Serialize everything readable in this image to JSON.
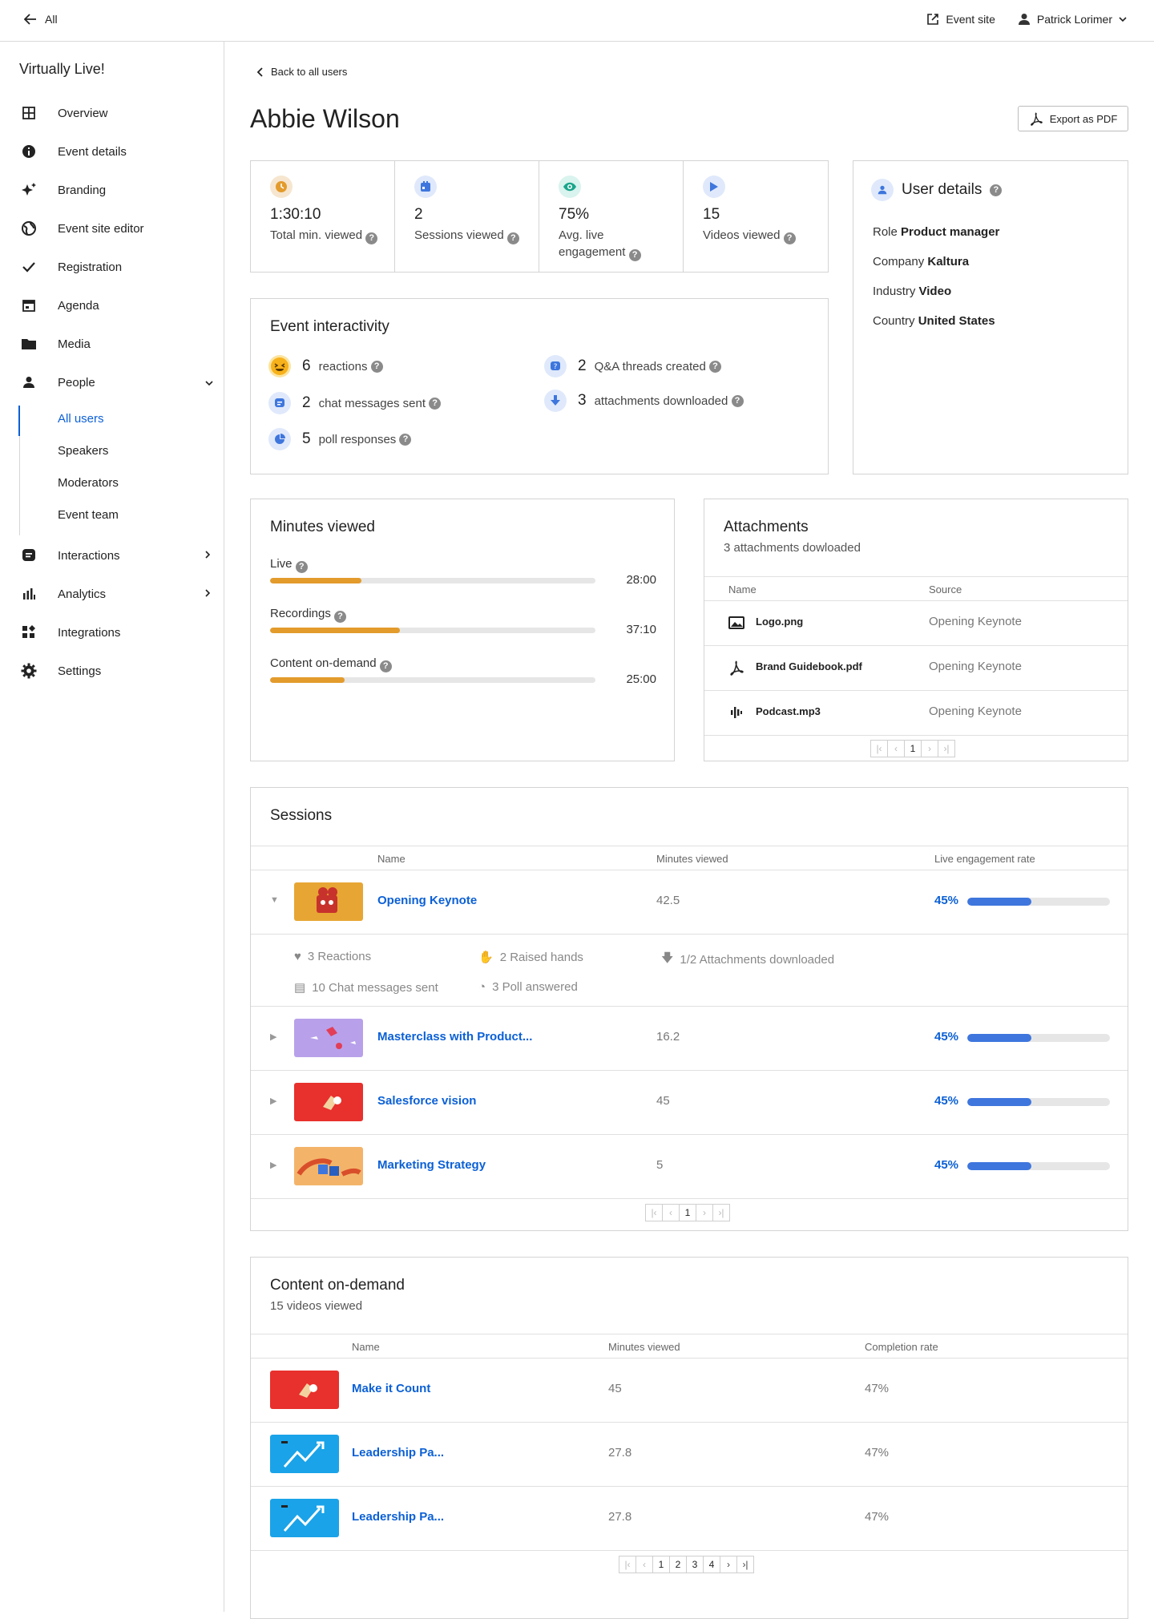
{
  "topbar": {
    "back_label": "All",
    "event_site": "Event site",
    "user": "Patrick Lorimer"
  },
  "sidebar": {
    "app_name": "Virtually Live!",
    "items": [
      {
        "label": "Overview",
        "icon": "grid-icon"
      },
      {
        "label": "Event details",
        "icon": "info-icon"
      },
      {
        "label": "Branding",
        "icon": "sparkle-icon"
      },
      {
        "label": "Event site editor",
        "icon": "globe-icon"
      },
      {
        "label": "Registration",
        "icon": "check-icon"
      },
      {
        "label": "Agenda",
        "icon": "calendar-icon"
      },
      {
        "label": "Media",
        "icon": "folder-icon"
      },
      {
        "label": "People",
        "icon": "person-icon"
      },
      {
        "label": "Interactions",
        "icon": "chat-icon"
      },
      {
        "label": "Analytics",
        "icon": "bar-chart-icon"
      },
      {
        "label": "Integrations",
        "icon": "apps-icon"
      },
      {
        "label": "Settings",
        "icon": "gear-icon"
      }
    ],
    "people_sub": [
      "All users",
      "Speakers",
      "Moderators",
      "Event team"
    ]
  },
  "page": {
    "back": "Back to all users",
    "title": "Abbie Wilson",
    "export": "Export as PDF"
  },
  "stats": [
    {
      "value": "1:30:10",
      "label": "Total min. viewed",
      "color": "#f6e6cf",
      "icon": "clock-icon"
    },
    {
      "value": "2",
      "label": "Sessions viewed",
      "color": "#dfe9fb",
      "icon": "calendar-icon"
    },
    {
      "value": "75%",
      "label": "Avg. live engagement",
      "color": "#d9f3ee",
      "icon": "eye-icon"
    },
    {
      "value": "15",
      "label": "Videos viewed",
      "color": "#dfe9fb",
      "icon": "play-icon"
    }
  ],
  "user_details": {
    "title": "User details",
    "rows": [
      {
        "key": "Role",
        "value": "Product manager"
      },
      {
        "key": "Company",
        "value": "Kaltura"
      },
      {
        "key": "Industry",
        "value": "Video"
      },
      {
        "key": "Country",
        "value": "United States"
      }
    ]
  },
  "interactivity": {
    "title": "Event interactivity",
    "left": [
      {
        "n": "6",
        "label": "reactions",
        "icon": "emoji-icon"
      },
      {
        "n": "2",
        "label": "chat messages sent",
        "icon": "chat-icon"
      },
      {
        "n": "5",
        "label": "poll responses",
        "icon": "poll-icon"
      }
    ],
    "right": [
      {
        "n": "2",
        "label": "Q&A threads created",
        "icon": "question-icon"
      },
      {
        "n": "3",
        "label": "attachments downloaded",
        "icon": "download-icon"
      }
    ]
  },
  "minutes": {
    "title": "Minutes viewed",
    "rows": [
      {
        "label": "Live",
        "value": "28:00",
        "fraction": 0.28
      },
      {
        "label": "Recordings",
        "value": "37:10",
        "fraction": 0.4
      },
      {
        "label": "Content on-demand",
        "value": "25:00",
        "fraction": 0.23
      }
    ]
  },
  "attachments": {
    "title": "Attachments",
    "subtitle": "3 attachments dowloaded",
    "headers": [
      "Name",
      "Source"
    ],
    "rows": [
      {
        "name": "Logo.png",
        "source": "Opening Keynote",
        "icon": "image-icon"
      },
      {
        "name": "Brand Guidebook.pdf",
        "source": "Opening Keynote",
        "icon": "pdf-icon"
      },
      {
        "name": "Podcast.mp3",
        "source": "Opening Keynote",
        "icon": "audio-icon"
      }
    ],
    "pager": [
      "1"
    ]
  },
  "sessions": {
    "title": "Sessions",
    "headers": [
      "Name",
      "Minutes viewed",
      "Live engagement rate"
    ],
    "rows": [
      {
        "name": "Opening Keynote",
        "minutes": "42.5",
        "rate": "45%",
        "fraction": 0.45,
        "color": "#e7a633"
      },
      {
        "name": "Masterclass with Product...",
        "minutes": "16.2",
        "rate": "45%",
        "fraction": 0.45,
        "color": "#b8a1ea"
      },
      {
        "name": "Salesforce vision",
        "minutes": "45",
        "rate": "45%",
        "fraction": 0.45,
        "color": "#e8302c"
      },
      {
        "name": "Marketing Strategy",
        "minutes": "5",
        "rate": "45%",
        "fraction": 0.45,
        "color": "#f3b46a"
      }
    ],
    "details": [
      "3 Reactions",
      "2 Raised hands",
      "1/2 Attachments downloaded",
      "10 Chat messages sent",
      "3 Poll answered"
    ],
    "pager": [
      "1"
    ]
  },
  "content": {
    "title": "Content on-demand",
    "subtitle": "15 videos viewed",
    "headers": [
      "Name",
      "Minutes viewed",
      "Completion rate"
    ],
    "rows": [
      {
        "name": "Make it Count",
        "minutes": "45",
        "rate": "47%",
        "color": "#e8302c"
      },
      {
        "name": "Leadership Pa...",
        "minutes": "27.8",
        "rate": "47%",
        "color": "#1aa3e8"
      },
      {
        "name": "Leadership Pa...",
        "minutes": "27.8",
        "rate": "47%",
        "color": "#1aa3e8"
      }
    ],
    "pager": [
      "1",
      "2",
      "3",
      "4"
    ]
  }
}
